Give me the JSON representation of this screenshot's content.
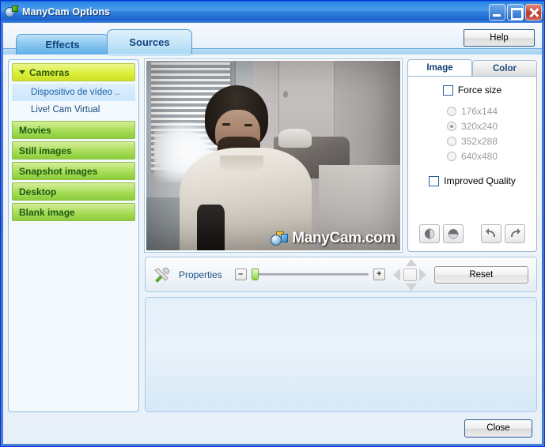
{
  "window": {
    "title": "ManyCam Options",
    "icon": "manycam-icon",
    "controls": {
      "minimize": "Minimize",
      "maximize": "Maximize",
      "close": "Close"
    }
  },
  "tabs": {
    "items": [
      {
        "label": "Effects",
        "active": false
      },
      {
        "label": "Sources",
        "active": true
      }
    ],
    "help_label": "Help"
  },
  "sidebar": {
    "categories": [
      {
        "label": "Cameras",
        "expanded": true,
        "items": [
          {
            "label": "Dispositivo de vídeo ..",
            "selected": true
          },
          {
            "label": "Live! Cam Virtual",
            "selected": false
          }
        ]
      },
      {
        "label": "Movies",
        "expanded": false,
        "items": []
      },
      {
        "label": "Still images",
        "expanded": false,
        "items": []
      },
      {
        "label": "Snapshot images",
        "expanded": false,
        "items": []
      },
      {
        "label": "Desktop",
        "expanded": false,
        "items": []
      },
      {
        "label": "Blank image",
        "expanded": false,
        "items": []
      }
    ]
  },
  "preview": {
    "watermark_text": "ManyCam.com",
    "watermark_icon": "manycam-watermark-icon",
    "description": "Webcam live preview"
  },
  "settings": {
    "tabs": [
      {
        "label": "Image",
        "active": true
      },
      {
        "label": "Color",
        "active": false
      }
    ],
    "force_size": {
      "label": "Force size",
      "checked": false
    },
    "resolutions": [
      {
        "label": "176x144",
        "selected": false,
        "disabled": true
      },
      {
        "label": "320x240",
        "selected": true,
        "disabled": true
      },
      {
        "label": "352x288",
        "selected": false,
        "disabled": true
      },
      {
        "label": "640x480",
        "selected": false,
        "disabled": true
      }
    ],
    "improved_quality": {
      "label": "Improved Quality",
      "checked": false
    },
    "transform_buttons": [
      {
        "name": "flip-horizontal-icon",
        "title": "Flip horizontal"
      },
      {
        "name": "flip-vertical-icon",
        "title": "Flip vertical"
      },
      {
        "name": "rotate-left-icon",
        "title": "Rotate left"
      },
      {
        "name": "rotate-right-icon",
        "title": "Rotate right"
      }
    ]
  },
  "properties": {
    "label": "Properties",
    "icon": "tools-icon",
    "zoom_out_label": "–",
    "zoom_in_label": "+",
    "zoom_value": 0,
    "reset_label": "Reset"
  },
  "footer": {
    "close_label": "Close"
  },
  "colors": {
    "titlebar_blue": "#2f7fdd",
    "category_green": "#a9dd5a",
    "category_active_yellow": "#dcef3c",
    "tab_blue": "#8cc8ef",
    "accent_text": "#15497c"
  }
}
